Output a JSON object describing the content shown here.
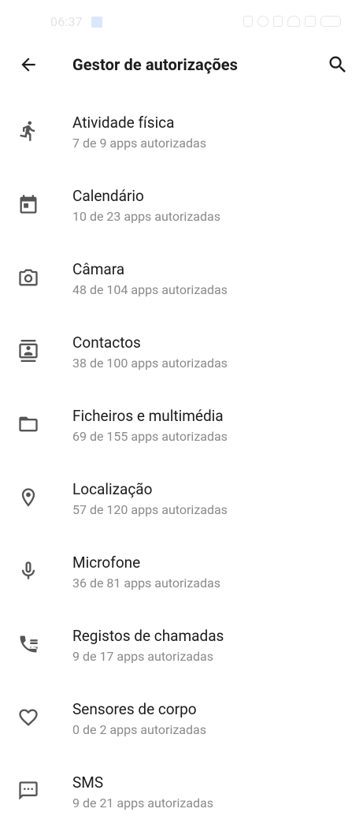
{
  "status_bar": {
    "time": "06:37"
  },
  "app_bar": {
    "title": "Gestor de autorizações"
  },
  "permissions": [
    {
      "title": "Atividade física",
      "subtitle": "7 de 9 apps autorizadas",
      "icon": "running-person-icon"
    },
    {
      "title": "Calendário",
      "subtitle": "10 de 23 apps autorizadas",
      "icon": "calendar-icon"
    },
    {
      "title": "Câmara",
      "subtitle": "48 de 104 apps autorizadas",
      "icon": "camera-icon"
    },
    {
      "title": "Contactos",
      "subtitle": "38 de 100 apps autorizadas",
      "icon": "contacts-icon"
    },
    {
      "title": "Ficheiros e multimédia",
      "subtitle": "69 de 155 apps autorizadas",
      "icon": "folder-icon"
    },
    {
      "title": "Localização",
      "subtitle": "57 de 120 apps autorizadas",
      "icon": "location-pin-icon"
    },
    {
      "title": "Microfone",
      "subtitle": "36 de 81 apps autorizadas",
      "icon": "microphone-icon"
    },
    {
      "title": "Registos de chamadas",
      "subtitle": "9 de 17 apps autorizadas",
      "icon": "call-log-icon"
    },
    {
      "title": "Sensores de corpo",
      "subtitle": "0 de 2 apps autorizadas",
      "icon": "heart-icon"
    },
    {
      "title": "SMS",
      "subtitle": "9 de 21 apps autorizadas",
      "icon": "message-icon"
    }
  ]
}
